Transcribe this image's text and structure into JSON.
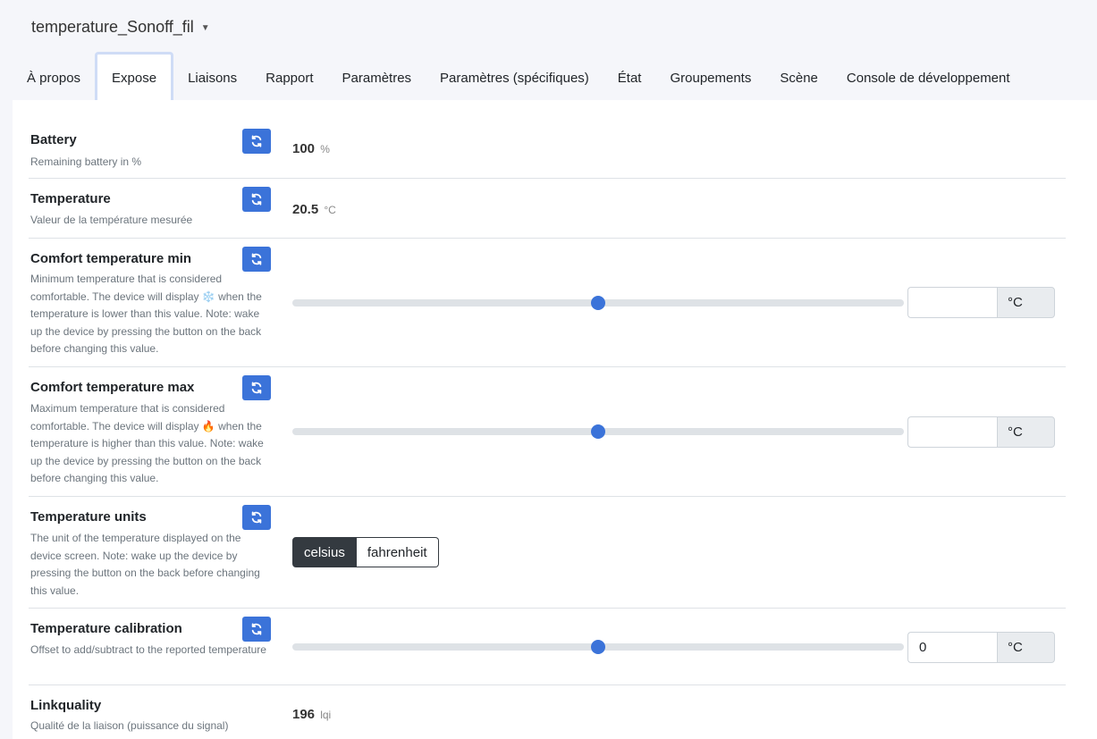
{
  "device": {
    "title": "temperature_Sonoff_fil",
    "dropdown_icon": "chevron-down-icon"
  },
  "tabs": [
    {
      "label": "À propos"
    },
    {
      "label": "Expose"
    },
    {
      "label": "Liaisons"
    },
    {
      "label": "Rapport"
    },
    {
      "label": "Paramètres"
    },
    {
      "label": "Paramètres (spécifiques)"
    },
    {
      "label": "État"
    },
    {
      "label": "Groupements"
    },
    {
      "label": "Scène"
    },
    {
      "label": "Console de développement"
    }
  ],
  "active_tab": "Expose",
  "colors": {
    "accent": "#3b73d9",
    "active_tab_border": "#cfdcf6",
    "toggle_selected": "#343a40"
  },
  "rows": {
    "battery": {
      "name": "Battery",
      "desc": "Remaining battery in %",
      "value": "100",
      "unit": "%"
    },
    "temperature": {
      "name": "Temperature",
      "desc": "Valeur de la température mesurée",
      "value": "20.5",
      "unit": "°C"
    },
    "comfort_min": {
      "name": "Comfort temperature min",
      "desc": "Minimum temperature that is considered comfortable. The device will display ❄️ when the temperature is lower than this value. Note: wake up the device by pressing the button on the back before changing this value.",
      "input_value": "",
      "unit": "°C",
      "slider_fraction": 0.5
    },
    "comfort_max": {
      "name": "Comfort temperature max",
      "desc": "Maximum temperature that is considered comfortable. The device will display 🔥 when the temperature is higher than this value. Note: wake up the device by pressing the button on the back before changing this value.",
      "input_value": "",
      "unit": "°C",
      "slider_fraction": 0.5
    },
    "units": {
      "name": "Temperature units",
      "desc": "The unit of the temperature displayed on the device screen. Note: wake up the device by pressing the button on the back before changing this value.",
      "options": [
        "celsius",
        "fahrenheit"
      ],
      "selected": "celsius"
    },
    "calibration": {
      "name": "Temperature calibration",
      "desc": "Offset to add/subtract to the reported temperature",
      "input_value": "0",
      "unit": "°C",
      "slider_fraction": 0.5
    },
    "linkquality": {
      "name": "Linkquality",
      "desc": "Qualité de la liaison (puissance du signal)",
      "value": "196",
      "unit": "lqi"
    }
  }
}
